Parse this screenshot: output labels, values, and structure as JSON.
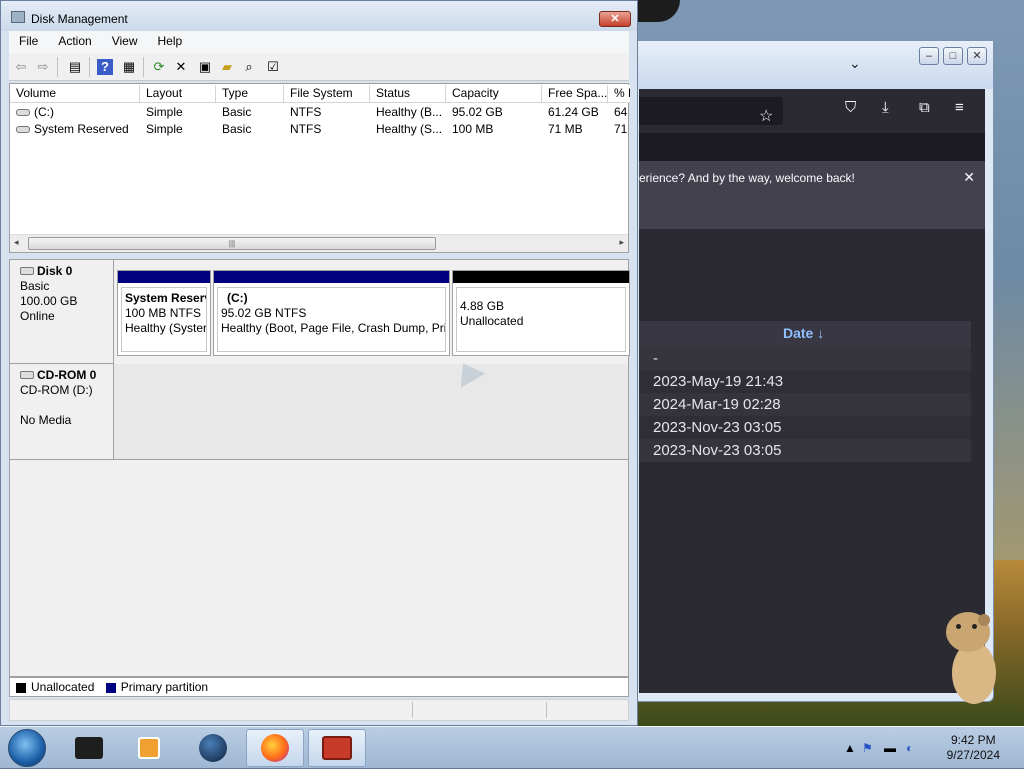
{
  "disk_management": {
    "title": "Disk Management",
    "close_glyph": "✕",
    "menu": [
      "File",
      "Action",
      "View",
      "Help"
    ],
    "columns": [
      "Volume",
      "Layout",
      "Type",
      "File System",
      "Status",
      "Capacity",
      "Free Spa...",
      "% F"
    ],
    "volumes": [
      {
        "volume": "(C:)",
        "layout": "Simple",
        "type": "Basic",
        "fs": "NTFS",
        "status": "Healthy (B...",
        "capacity": "95.02 GB",
        "free": "61.24 GB",
        "pct": "64"
      },
      {
        "volume": "System Reserved",
        "layout": "Simple",
        "type": "Basic",
        "fs": "NTFS",
        "status": "Healthy (S...",
        "capacity": "100 MB",
        "free": "71 MB",
        "pct": "71"
      }
    ],
    "disks": [
      {
        "name": "Disk 0",
        "type": "Basic",
        "size": "100.00 GB",
        "state": "Online"
      },
      {
        "name": "CD-ROM 0",
        "type": "CD-ROM (D:)",
        "state": "No Media"
      }
    ],
    "partitions": [
      {
        "name": "System Reserv",
        "size": "100 MB NTFS",
        "status": "Healthy (Syster"
      },
      {
        "name": "(C:)",
        "size": "95.02 GB NTFS",
        "status": "Healthy (Boot, Page File, Crash Dump, Prir"
      },
      {
        "size": "4.88 GB",
        "status": "Unallocated"
      }
    ],
    "legend": {
      "unallocated": "Unallocated",
      "primary": "Primary partition"
    },
    "colors": {
      "primary": "#000080",
      "unallocated": "#000000",
      "close": "#c6402c"
    }
  },
  "firefox": {
    "notice": "erience? And by the way, welcome back!",
    "close_glyph": "✕",
    "table_header": "Date ↓",
    "dates": [
      "-",
      "2023-May-19 21:43",
      "2024-Mar-19 02:28",
      "2023-Nov-23 03:05",
      "2023-Nov-23 03:05"
    ],
    "colors": {
      "header": "#8fc0ff",
      "bg": "#2b2a33"
    }
  },
  "taskbar": {
    "time": "9:42 PM",
    "date": "9/27/2024",
    "tray_chevron": "▲",
    "items": [
      "explorer-icon",
      "media-player-icon",
      "browser-globe-icon",
      "firefox-icon",
      "disk-management-icon"
    ]
  }
}
